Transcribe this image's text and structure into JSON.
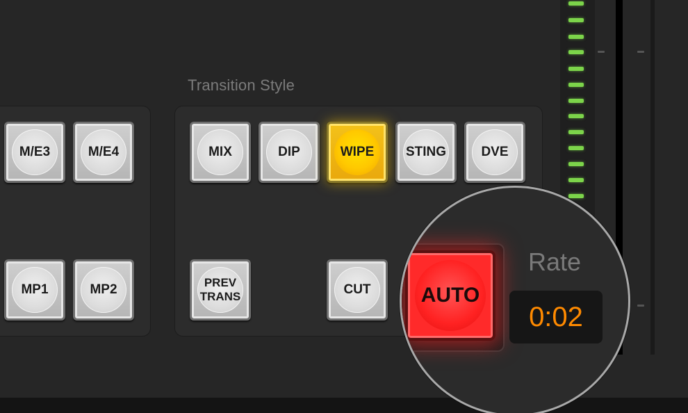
{
  "section": {
    "transition_style_label": "Transition Style"
  },
  "left_panel": {
    "row1": [
      "M/E3",
      "M/E4"
    ],
    "row2": [
      "MP1",
      "MP2"
    ]
  },
  "transition_style": {
    "buttons": [
      "MIX",
      "DIP",
      "WIPE",
      "STING",
      "DVE"
    ],
    "selected": "WIPE"
  },
  "transition_controls": {
    "prev_trans": "PREV\nTRANS",
    "cut": "CUT",
    "auto": "AUTO"
  },
  "rate": {
    "label": "Rate",
    "value": "0:02"
  },
  "colors": {
    "selected_yellow": "#ffc800",
    "auto_red": "#ff2a2a",
    "rate_orange": "#ff8a00",
    "led_green": "#7cd44a"
  }
}
